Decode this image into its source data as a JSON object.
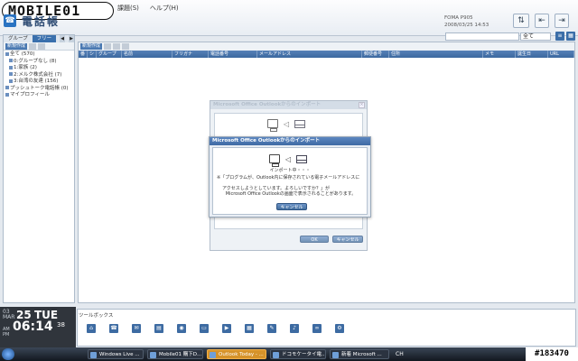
{
  "watermark": {
    "logo_text": "MOBILE01",
    "post_id": "#183470"
  },
  "header": {
    "app_title": "電話帳",
    "menu": [
      "課題(S)",
      "ヘルプ(H)"
    ],
    "owner_line1": "FOMA P905",
    "owner_line2": "2008/03/25 14:53",
    "search_placeholder": "",
    "search_scope": "全て"
  },
  "leftpane": {
    "tabs": [
      "グループ",
      "フリー"
    ],
    "new_button": "新規作成",
    "tree": [
      {
        "label": "全て (570)",
        "level": 0
      },
      {
        "label": "0:グループなし (8)",
        "level": 1
      },
      {
        "label": "1:家族 (2)",
        "level": 1
      },
      {
        "label": "2:メルク株式会社 (7)",
        "level": 1
      },
      {
        "label": "3:台湾の友達 (156)",
        "level": 1
      },
      {
        "label": "プッシュトーク電話帳 (0)",
        "level": 0
      },
      {
        "label": "マイプロフィール",
        "level": 0
      }
    ]
  },
  "main": {
    "new_button": "新規作成",
    "columns": [
      "番",
      "シ",
      "グループ",
      "名前",
      "フリガナ",
      "電話番号",
      "メールアドレス",
      "郵便番号",
      "住所",
      "メモ",
      "誕生日",
      "URL"
    ]
  },
  "dialog_back": {
    "title": "Microsoft Office Outlookからのインポート",
    "ok": "OK",
    "cancel": "キャンセル"
  },
  "dialog_front": {
    "title": "Microsoft Office Outlookからのインポート",
    "status": "インポート中・・・",
    "message1": "※「プログラムが、Outlook内に保存されている電子メールアドレスに",
    "message2": "アクセスしようとしています。よろしいですか？」が",
    "message3": "Microsoft Office Outlookの画面で表示されることがあります。",
    "cancel": "キャンセル"
  },
  "toolpane": {
    "label": "ツールボックス",
    "icons": [
      "home-icon",
      "phonebook-icon",
      "mail-icon",
      "calendar-icon",
      "camera-icon",
      "tv-icon",
      "video-icon",
      "document-icon",
      "bookmark-icon",
      "music-icon",
      "link-icon",
      "settings-icon"
    ]
  },
  "clock": {
    "month": "03",
    "month_label": "MAR",
    "day": "25",
    "weekday": "TUE",
    "am": "AM",
    "pm": "PM",
    "time": "06:14",
    "seconds": "38"
  },
  "taskbar": {
    "tasks": [
      {
        "label": "Windows Live ...",
        "active": false
      },
      {
        "label": "Mobile01 購下D...",
        "active": false
      },
      {
        "label": "Outlook Today - ...",
        "active": true
      },
      {
        "label": "ドコモケータイ電...",
        "active": false
      },
      {
        "label": "新着 Microsoft ...",
        "active": false
      }
    ],
    "tray": "CH"
  },
  "colors": {
    "accent": "#3a70ad",
    "taskbar": "#12171f",
    "active_task": "#d6932a"
  }
}
